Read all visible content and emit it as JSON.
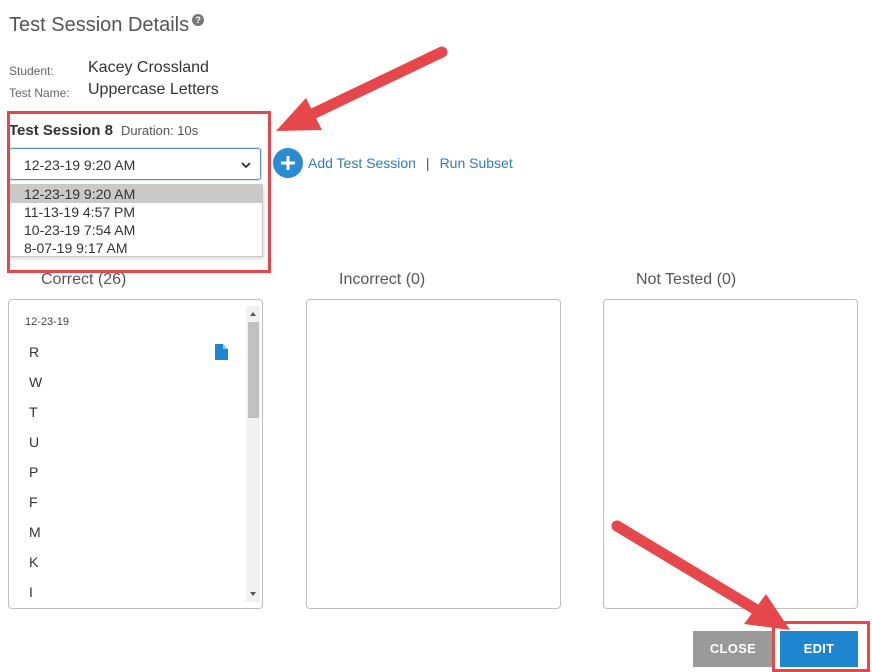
{
  "header": {
    "title": "Test Session Details",
    "help_glyph": "?"
  },
  "meta": {
    "student_label": "Student:",
    "student_value": "Kacey Crossland",
    "test_label": "Test Name:",
    "test_value": "Uppercase Letters"
  },
  "session": {
    "title": "Test Session 8",
    "duration": "Duration: 10s",
    "selected": "12-23-19 9:20 AM",
    "options": [
      "12-23-19 9:20 AM",
      "11-13-19 4:57 PM",
      "10-23-19 7:54 AM",
      "8-07-19 9:17 AM"
    ]
  },
  "actions": {
    "add_session": "Add Test Session",
    "separator": "|",
    "run_subset": "Run Subset"
  },
  "columns": {
    "correct": "Correct (26)",
    "incorrect": "Incorrect (0)",
    "not_tested": "Not Tested (0)"
  },
  "correct_panel": {
    "date": "12-23-19",
    "letters": [
      "R",
      "W",
      "T",
      "U",
      "P",
      "F",
      "M",
      "K",
      "I"
    ],
    "note_icon": "document-icon"
  },
  "buttons": {
    "close": "CLOSE",
    "edit": "EDIT"
  },
  "colors": {
    "accent": "#1e86d1",
    "link": "#2f7bbf",
    "annotation": "#e5474b",
    "close_button": "#9a9a9a"
  }
}
